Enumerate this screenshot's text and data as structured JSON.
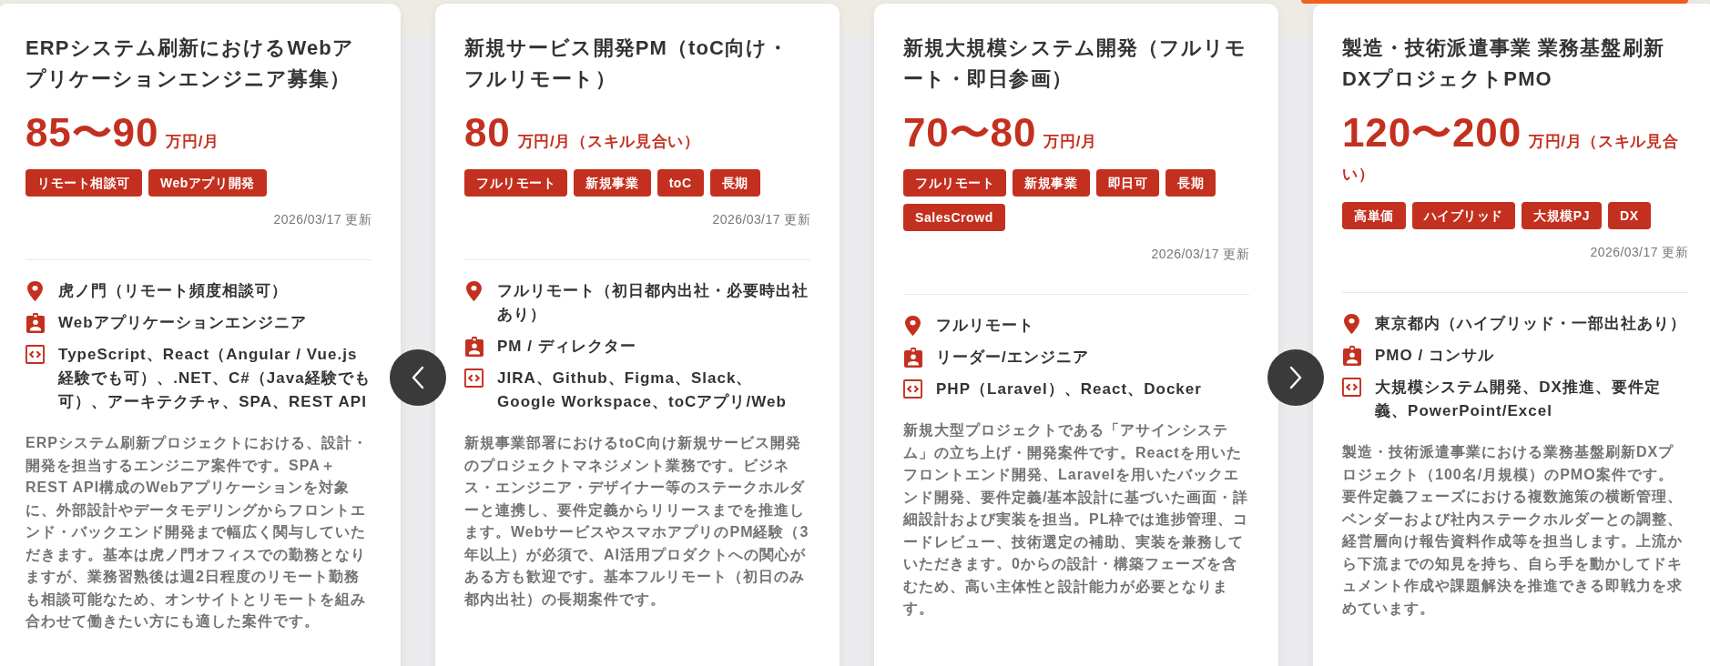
{
  "cards": [
    {
      "title": "ERPシステム刷新におけるWebアプリケーションエンジニア募集）",
      "price": {
        "amount": "85〜90",
        "unit": "万円/月"
      },
      "tags": [
        "リモート相談可",
        "Webアプリ開発"
      ],
      "updated": "2026/03/17 更新",
      "details": [
        {
          "kind": "location",
          "text": "虎ノ門（リモート頻度相談可）"
        },
        {
          "kind": "role",
          "text": "Webアプリケーションエンジニア"
        },
        {
          "kind": "skills",
          "text": "TypeScript、React（Angular / Vue.js経験でも可）、.NET、C#（Java経験でも可）、アーキテクチャ、SPA、REST API"
        }
      ],
      "description": "ERPシステム刷新プロジェクトにおける、設計・開発を担当するエンジニア案件です。SPA＋REST API構成のWebアプリケーションを対象に、外部設計やデータモデリングからフロントエンド・バックエンド開発まで幅広く関与していただきます。基本は虎ノ門オフィスでの勤務となりますが、業務習熟後は週2日程度のリモート勤務も相談可能なため、オンサイトとリモートを組み合わせて働きたい方にも適した案件です。"
    },
    {
      "title": "新規サービス開発PM（toC向け・フルリモート）",
      "price": {
        "amount": "80",
        "unit": "万円/月（スキル見合い）"
      },
      "tags": [
        "フルリモート",
        "新規事業",
        "toC",
        "長期"
      ],
      "updated": "2026/03/17 更新",
      "details": [
        {
          "kind": "location",
          "text": "フルリモート（初日都内出社・必要時出社あり）"
        },
        {
          "kind": "role",
          "text": "PM / ディレクター"
        },
        {
          "kind": "skills",
          "text": "JIRA、Github、Figma、Slack、Google Workspace、toCアプリ/Web"
        }
      ],
      "description": "新規事業部署におけるtoC向け新規サービス開発のプロジェクトマネジメント業務です。ビジネス・エンジニア・デザイナー等のステークホルダーと連携し、要件定義からリリースまでを推進します。WebサービスやスマホアプリのPM経験（3年以上）が必須で、AI活用プロダクトへの関心がある方も歓迎です。基本フルリモート（初日のみ都内出社）の長期案件です。"
    },
    {
      "title": "新規大規模システム開発（フルリモート・即日参画）",
      "price": {
        "amount": "70〜80",
        "unit": "万円/月"
      },
      "tags": [
        "フルリモート",
        "新規事業",
        "即日可",
        "長期",
        "SalesCrowd"
      ],
      "updated": "2026/03/17 更新",
      "details": [
        {
          "kind": "location",
          "text": "フルリモート"
        },
        {
          "kind": "role",
          "text": "リーダー/エンジニア"
        },
        {
          "kind": "skills",
          "text": "PHP（Laravel）、React、Docker"
        }
      ],
      "description": "新規大型プロジェクトである「アサインシステム」の立ち上げ・開発案件です。Reactを用いたフロントエンド開発、Laravelを用いたバックエンド開発、要件定義/基本設計に基づいた画面・詳細設計および実装を担当。PL枠では進捗管理、コードレビュー、技術選定の補助、実装を兼務していただきます。0からの設計・構築フェーズを含むため、高い主体性と設計能力が必要となります。"
    },
    {
      "title": "製造・技術派遣事業 業務基盤刷新DXプロジェクトPMO",
      "price": {
        "amount": "120〜200",
        "unit": "万円/月（スキル見合い）"
      },
      "tags": [
        "高単価",
        "ハイブリッド",
        "大規模PJ",
        "DX"
      ],
      "updated": "2026/03/17 更新",
      "details": [
        {
          "kind": "location",
          "text": "東京都内（ハイブリッド・一部出社あり）"
        },
        {
          "kind": "role",
          "text": "PMO / コンサル"
        },
        {
          "kind": "skills",
          "text": "大規模システム開発、DX推進、要件定義、PowerPoint/Excel"
        }
      ],
      "description": "製造・技術派遣事業における業務基盤刷新DXプロジェクト（100名/月規模）のPMO案件です。要件定義フェーズにおける複数施策の横断管理、ベンダーおよび社内ステークホルダーとの調整、経営層向け報告資料作成等を担当します。上流から下流までの知見を持ち、自ら手を動かしてドキュメント作成や課題解決を推進できる即戦力を求めています。"
    }
  ]
}
